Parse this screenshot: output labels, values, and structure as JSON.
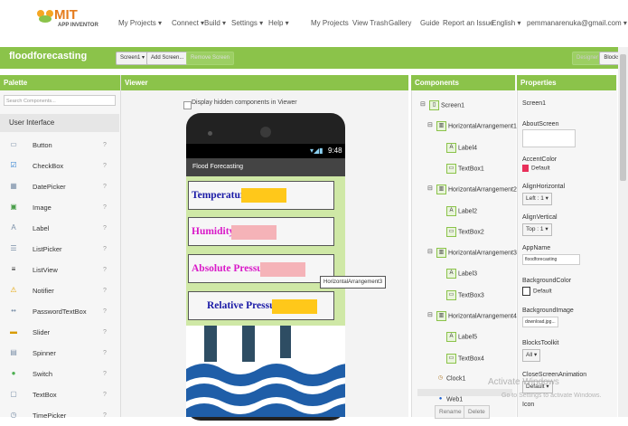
{
  "app": {
    "logo_text": "MIT",
    "logo_sub": "APP INVENTOR"
  },
  "topnav": {
    "items": [
      "My Projects ▾",
      "Connect ▾",
      "Build ▾",
      "Settings ▾",
      "Help ▾",
      "My Projects",
      "View Trash",
      "Gallery",
      "Guide",
      "Report an Issue",
      "English ▾",
      "pemmanarenuka@gmail.com ▾"
    ]
  },
  "project": {
    "name": "floodforecasting",
    "screen_select": "Screen1 ▾",
    "add_screen": "Add Screen...",
    "remove_screen": "Remove Screen",
    "designer": "Designer",
    "blocks": "Blocks"
  },
  "palette": {
    "title": "Palette",
    "search_placeholder": "Search Components...",
    "category": "User Interface",
    "items": [
      {
        "label": "Button",
        "icon": "button-icon"
      },
      {
        "label": "CheckBox",
        "icon": "checkbox-icon"
      },
      {
        "label": "DatePicker",
        "icon": "datepicker-icon"
      },
      {
        "label": "Image",
        "icon": "image-icon"
      },
      {
        "label": "Label",
        "icon": "label-icon"
      },
      {
        "label": "ListPicker",
        "icon": "listpicker-icon"
      },
      {
        "label": "ListView",
        "icon": "listview-icon"
      },
      {
        "label": "Notifier",
        "icon": "notifier-icon"
      },
      {
        "label": "PasswordTextBox",
        "icon": "password-icon"
      },
      {
        "label": "Slider",
        "icon": "slider-icon"
      },
      {
        "label": "Spinner",
        "icon": "spinner-icon"
      },
      {
        "label": "Switch",
        "icon": "switch-icon"
      },
      {
        "label": "TextBox",
        "icon": "textbox-icon"
      },
      {
        "label": "TimePicker",
        "icon": "timepicker-icon"
      }
    ],
    "help": "?"
  },
  "viewer": {
    "title": "Viewer",
    "hidden_toggle": "Display hidden components in Viewer",
    "time": "9:48",
    "app_title": "Flood Forecasting",
    "rows": [
      {
        "label": "Temperature",
        "color": "#1a1aa6",
        "box_color": "#ffc81a"
      },
      {
        "label": "Humidity",
        "color": "#d919c8",
        "box_color": "#f5b3b8"
      },
      {
        "label": "Absolute Pressure",
        "color": "#d919c8",
        "box_color": "#f5b3b8"
      },
      {
        "label": "Relative Pressure",
        "color": "#1a1aa6",
        "box_color": "#ffc81a"
      }
    ],
    "tooltip": "HorizontalArrangement3"
  },
  "components": {
    "title": "Components",
    "tree": [
      {
        "label": "Screen1",
        "level": 0,
        "icon": "screen-icon"
      },
      {
        "label": "HorizontalArrangement1",
        "level": 1,
        "icon": "arrangement-icon"
      },
      {
        "label": "Label4",
        "level": 2,
        "icon": "label-icon"
      },
      {
        "label": "TextBox1",
        "level": 2,
        "icon": "textbox-icon"
      },
      {
        "label": "HorizontalArrangement2",
        "level": 1,
        "icon": "arrangement-icon"
      },
      {
        "label": "Label2",
        "level": 2,
        "icon": "label-icon"
      },
      {
        "label": "TextBox2",
        "level": 2,
        "icon": "textbox-icon"
      },
      {
        "label": "HorizontalArrangement3",
        "level": 1,
        "icon": "arrangement-icon"
      },
      {
        "label": "Label3",
        "level": 2,
        "icon": "label-icon"
      },
      {
        "label": "TextBox3",
        "level": 2,
        "icon": "textbox-icon"
      },
      {
        "label": "HorizontalArrangement4",
        "level": 1,
        "icon": "arrangement-icon"
      },
      {
        "label": "Label5",
        "level": 2,
        "icon": "label-icon"
      },
      {
        "label": "TextBox4",
        "level": 2,
        "icon": "textbox-icon"
      },
      {
        "label": "Clock1",
        "level": 1,
        "icon": "clock-icon"
      },
      {
        "label": "Web1",
        "level": 1,
        "icon": "web-icon"
      }
    ],
    "rename": "Rename",
    "delete": "Delete"
  },
  "properties": {
    "title": "Properties",
    "component": "Screen1",
    "about_label": "AboutScreen",
    "accent_label": "AccentColor",
    "accent_value": "Default",
    "accent_color": "#e8305a",
    "align_h_label": "AlignHorizontal",
    "align_h_value": "Left : 1 ▾",
    "align_v_label": "AlignVertical",
    "align_v_value": "Top : 1 ▾",
    "appname_label": "AppName",
    "appname_value": "floodforecasting",
    "bg_label": "BackgroundColor",
    "bg_value": "Default",
    "bgimg_label": "BackgroundImage",
    "bgimg_value": "download.jpg...",
    "toolkit_label": "BlocksToolkit",
    "toolkit_value": "All ▾",
    "anim_label": "CloseScreenAnimation",
    "anim_value": "Default ▾",
    "icon_label": "Icon"
  },
  "watermark": {
    "line1": "Activate Windows",
    "line2": "Go to Settings to activate Windows."
  }
}
